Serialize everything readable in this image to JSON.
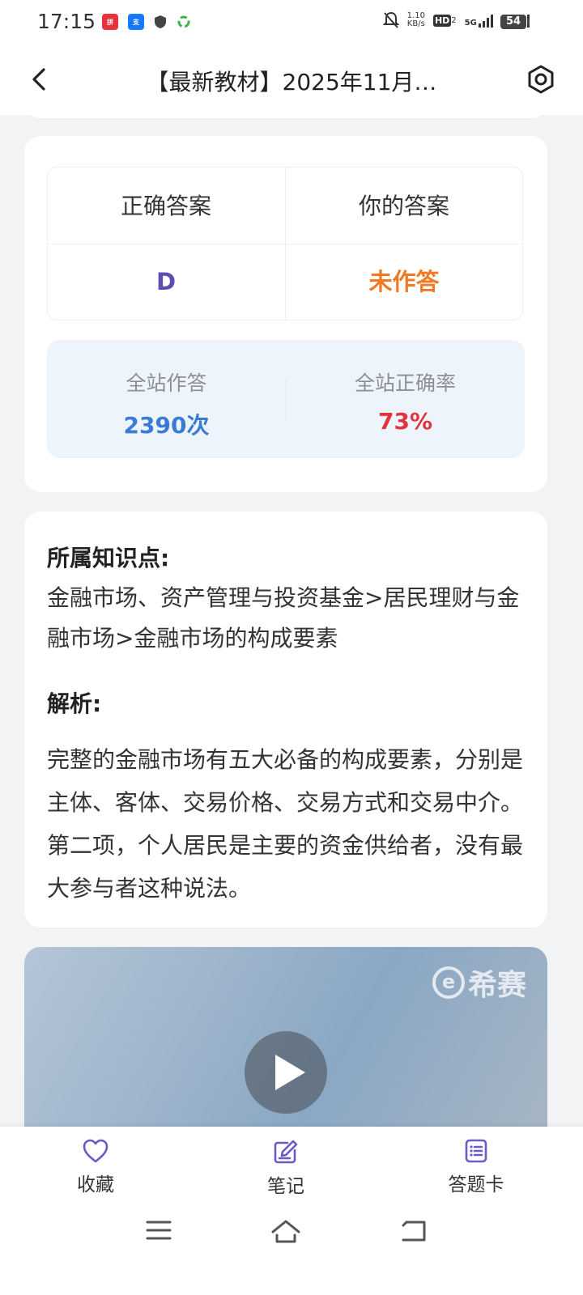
{
  "status_bar": {
    "time": "17:15",
    "net_speed_value": "1.10",
    "net_speed_unit": "KB/s",
    "hd_label": "HD",
    "hd_sub": "2",
    "sim1": "5G",
    "sim2": "5G",
    "battery": "54",
    "app_icon_1": "拼",
    "app_icon_2": "支"
  },
  "header": {
    "title": "【最新教材】2025年11月…"
  },
  "answer_card": {
    "correct_header": "正确答案",
    "yours_header": "你的答案",
    "correct_value": "D",
    "yours_value": "未作答",
    "stats": {
      "attempts_label": "全站作答",
      "attempts_value": "2390次",
      "rate_label": "全站正确率",
      "rate_value": "73%"
    }
  },
  "analysis_card": {
    "knowledge_title": "所属知识点:",
    "knowledge_text": "金融市场、资产管理与投资基金>居民理财与金融市场>金融市场的构成要素",
    "analysis_title": "解析:",
    "analysis_text": "完整的金融市场有五大必备的构成要素，分别是主体、客体、交易价格、交易方式和交易中介。第二项，个人居民是主要的资金供给者，没有最大参与者这种说法。"
  },
  "video": {
    "watermark": "希赛",
    "watermark_logo": "e"
  },
  "bottom_tabs": [
    {
      "label": "收藏",
      "icon": "heart-icon"
    },
    {
      "label": "笔记",
      "icon": "note-edit-icon"
    },
    {
      "label": "答题卡",
      "icon": "answer-sheet-icon"
    }
  ],
  "colors": {
    "correct": "#5b4fb3",
    "unanswered": "#f07a24",
    "attempts": "#3a7bd5",
    "rate": "#e2343f",
    "tab_icon": "#6a5bc8"
  }
}
